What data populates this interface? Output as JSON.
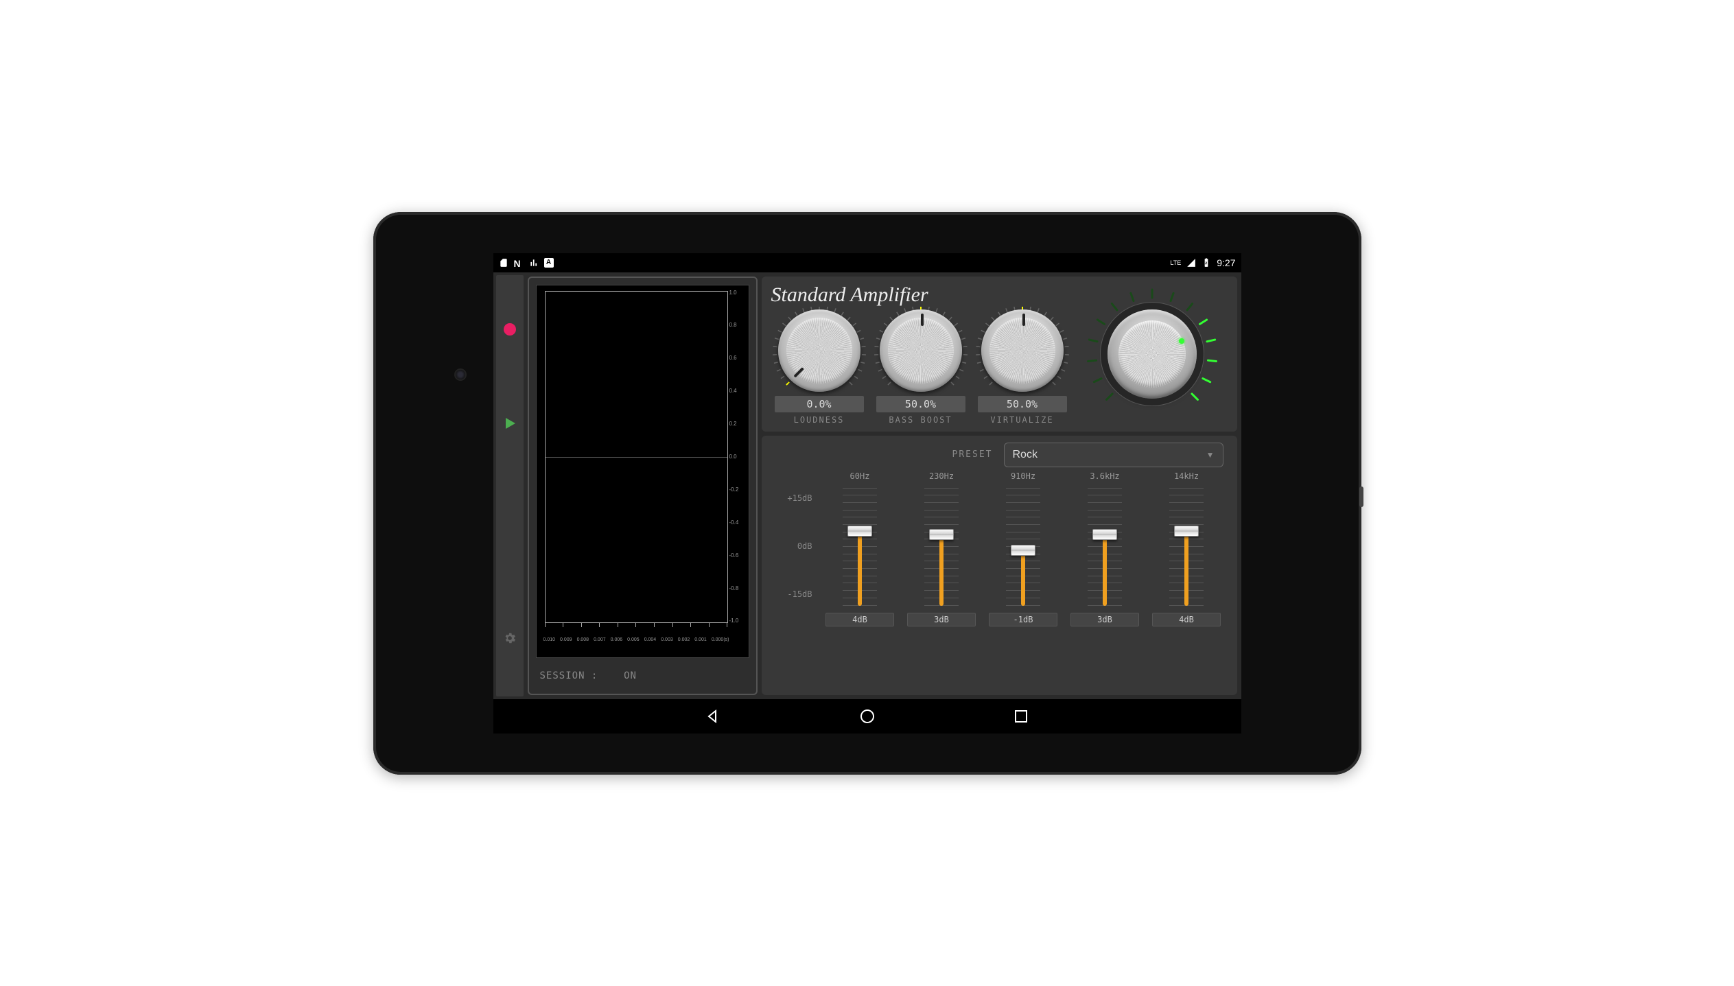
{
  "statusbar": {
    "network": "LTE",
    "clock": "9:27"
  },
  "session": {
    "label": "SESSION :",
    "value": "ON"
  },
  "graph": {
    "y_ticks": [
      "1.0",
      "0.8",
      "0.6",
      "0.4",
      "0.2",
      "0.0",
      "-0.2",
      "-0.4",
      "-0.6",
      "-0.8",
      "-1.0"
    ],
    "x_ticks": [
      "0.010",
      "0.009",
      "0.008",
      "0.007",
      "0.006",
      "0.005",
      "0.004",
      "0.003",
      "0.002",
      "0.001",
      "0.000(s)"
    ]
  },
  "amplifier": {
    "title": "Standard Amplifier",
    "knobs": [
      {
        "id": "loudness",
        "label": "LOUDNESS",
        "value": "0.0%",
        "angle": -135
      },
      {
        "id": "bassboost",
        "label": "BASS BOOST",
        "value": "50.0%",
        "angle": 0
      },
      {
        "id": "virtualize",
        "label": "VIRTUALIZE",
        "value": "50.0%",
        "angle": 0
      }
    ]
  },
  "equalizer": {
    "preset_label": "PRESET",
    "preset_value": "Rock",
    "scale": {
      "top": "+15dB",
      "mid": "0dB",
      "bot": "-15dB"
    },
    "bands": [
      {
        "freq": "60Hz",
        "db": "4dB",
        "pos": 4
      },
      {
        "freq": "230Hz",
        "db": "3dB",
        "pos": 3
      },
      {
        "freq": "910Hz",
        "db": "-1dB",
        "pos": -1
      },
      {
        "freq": "3.6kHz",
        "db": "3dB",
        "pos": 3
      },
      {
        "freq": "14kHz",
        "db": "4dB",
        "pos": 4
      }
    ]
  }
}
